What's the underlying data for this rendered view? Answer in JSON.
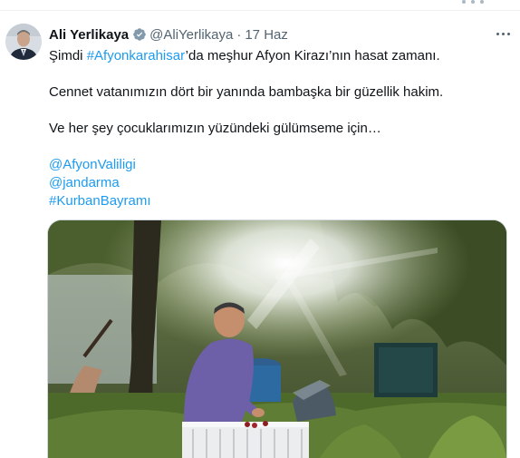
{
  "tweet": {
    "author_name": "Ali Yerlikaya",
    "author_handle": "@AliYerlikaya",
    "separator": "·",
    "date": "17 Haz",
    "lines": {
      "l1_pre": "Şimdi ",
      "l1_tag": "#Afyonkarahisar",
      "l1_post": "’da meşhur Afyon Kirazı’nın hasat zamanı.",
      "l2": "Cennet vatanımızın dört bir yanında bambaşka bir güzellik hakim.",
      "l3": "Ve her şey çocuklarımızın yüzündeki gülümseme için…",
      "mention1": "@AfyonValiligi",
      "mention2": "@jandarma",
      "hashtag2": "#KurbanBayramı"
    }
  },
  "icons": {
    "verified": "verified-badge-icon",
    "more": "more-horizontal-icon"
  },
  "colors": {
    "link": "#1d9bf0",
    "secondary_text": "#536471",
    "verified_badge": "#829aab"
  }
}
